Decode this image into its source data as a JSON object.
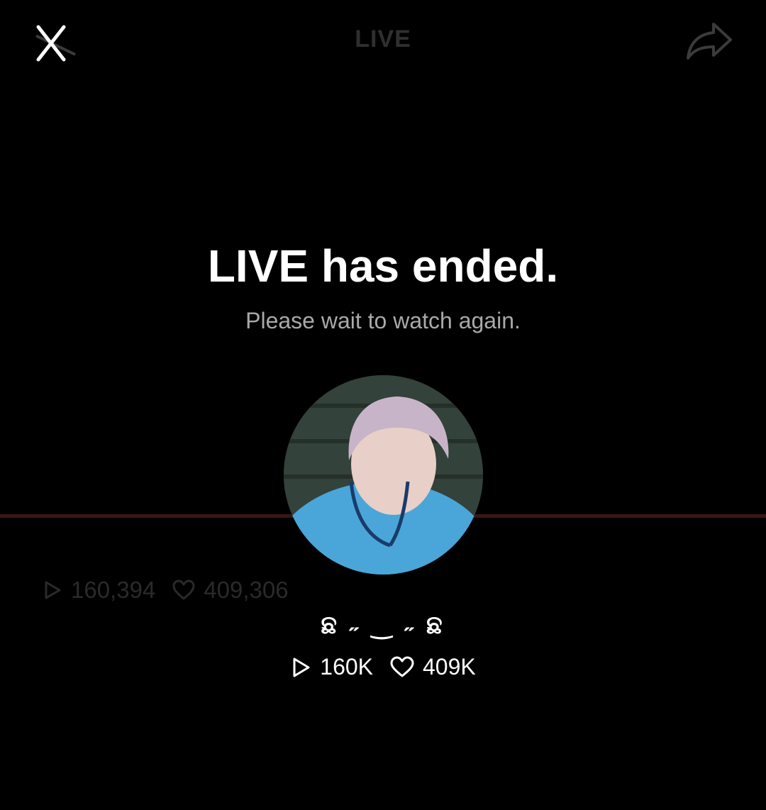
{
  "header": {
    "title": "LIVE"
  },
  "icons": {
    "close": "close-icon",
    "share": "share-icon",
    "play": "play-icon",
    "heart": "heart-icon"
  },
  "background": {
    "plays": "160,394",
    "likes": "409,306",
    "progress_line_color": "#3a1616"
  },
  "message": {
    "title": "LIVE has ended.",
    "subtitle": "Please wait to watch again."
  },
  "profile": {
    "username": "ଛ ˶ ‿ ˶ ଛ",
    "plays": "160K",
    "likes": "409K"
  }
}
